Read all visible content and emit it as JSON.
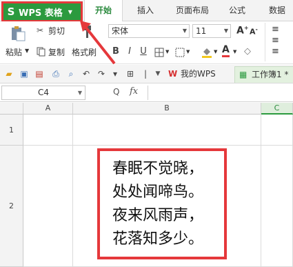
{
  "app_menu": {
    "label": "WPS 表格",
    "logo": "S"
  },
  "tabs": [
    {
      "label": "开始",
      "active": true
    },
    {
      "label": "插入",
      "active": false
    },
    {
      "label": "页面布局",
      "active": false
    },
    {
      "label": "公式",
      "active": false
    },
    {
      "label": "数据",
      "active": false
    }
  ],
  "ribbon": {
    "cut": "剪切",
    "paste": "粘贴",
    "copy": "复制",
    "format_painter": "格式刷",
    "font_name": "宋体",
    "font_size": "11",
    "bold": "B",
    "italic": "I",
    "underline": "U",
    "font_color_glyph": "A",
    "grow_font": "A",
    "shrink_font": "A"
  },
  "doc_tabs": [
    {
      "label": "我的WPS",
      "active": false
    },
    {
      "label": "工作簿1 *",
      "active": true
    }
  ],
  "formula_bar": {
    "name_box": "C4",
    "fx": "fx",
    "zoom_glyph": "Q"
  },
  "grid": {
    "columns": [
      "A",
      "B",
      "C"
    ],
    "rows": [
      "1",
      "2"
    ]
  },
  "poem": [
    "春眠不觉晓，",
    "处处闻啼鸟。",
    "夜来风雨声，",
    "花落知多少。"
  ],
  "colors": {
    "accent_green": "#2b9a3e",
    "highlight_red": "#e5383b"
  }
}
